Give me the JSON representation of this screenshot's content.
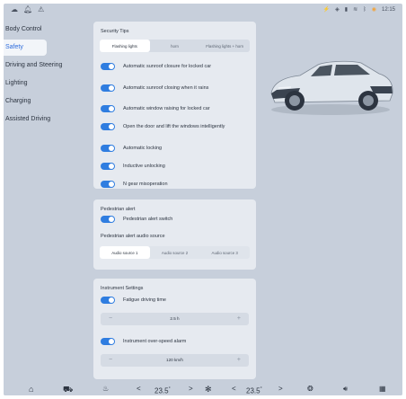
{
  "status_bar": {
    "left_icons": [
      "cloud-icon",
      "bell-icon",
      "warning-icon"
    ],
    "right_icons": [
      "lightning-icon",
      "media-icon",
      "signal-icon",
      "wifi-icon",
      "bluetooth-icon"
    ],
    "time": "12:15"
  },
  "sidebar": {
    "items": [
      {
        "label": "Body Control"
      },
      {
        "label": "Safety"
      },
      {
        "label": "Driving and Steering"
      },
      {
        "label": "Lighting"
      },
      {
        "label": "Charging"
      },
      {
        "label": "Assisted Driving"
      }
    ],
    "active": "Safety"
  },
  "security_tips": {
    "title": "Security Tips",
    "segments": [
      "Flashing lights",
      "horn",
      "Flashing lights + horn"
    ],
    "selected": "Flashing lights",
    "toggles": [
      {
        "label": "Automatic sunroof closure for locked car",
        "on": true
      },
      {
        "label": "Automatic sunroof closing when it rains",
        "on": true
      },
      {
        "label": "Automatic window raising for locked car",
        "on": true
      },
      {
        "label": "Open the door and lift the windows intelligently",
        "on": true
      },
      {
        "label": "Automatic locking",
        "on": true
      },
      {
        "label": "Inductive unlocking",
        "on": true
      },
      {
        "label": "N gear misoperation",
        "on": true
      }
    ]
  },
  "pedestrian": {
    "title": "Pedestrian alert",
    "switch_label": "Pedestrian alert switch",
    "source_label": "Pedestrian alert audio source",
    "sources": [
      "Audio source 1",
      "Audio source 2",
      "Audio source 3"
    ],
    "selected": "Audio source 1"
  },
  "instrument": {
    "title": "Instrument Settings",
    "fatigue_label": "Fatigue driving time",
    "fatigue_value": "2.5 h",
    "overspeed_label": "Instrument over-speed alarm",
    "overspeed_value": "120 km/h",
    "minus": "−",
    "plus": "+"
  },
  "bottom_bar": {
    "left_temp": "23.5",
    "right_temp": "23.5",
    "deg": "°",
    "left_arrow": "<",
    "right_arrow": ">"
  },
  "colors": {
    "accent": "#2f7de0",
    "background": "#c7cfdb",
    "panel": "#e6eaf0"
  }
}
